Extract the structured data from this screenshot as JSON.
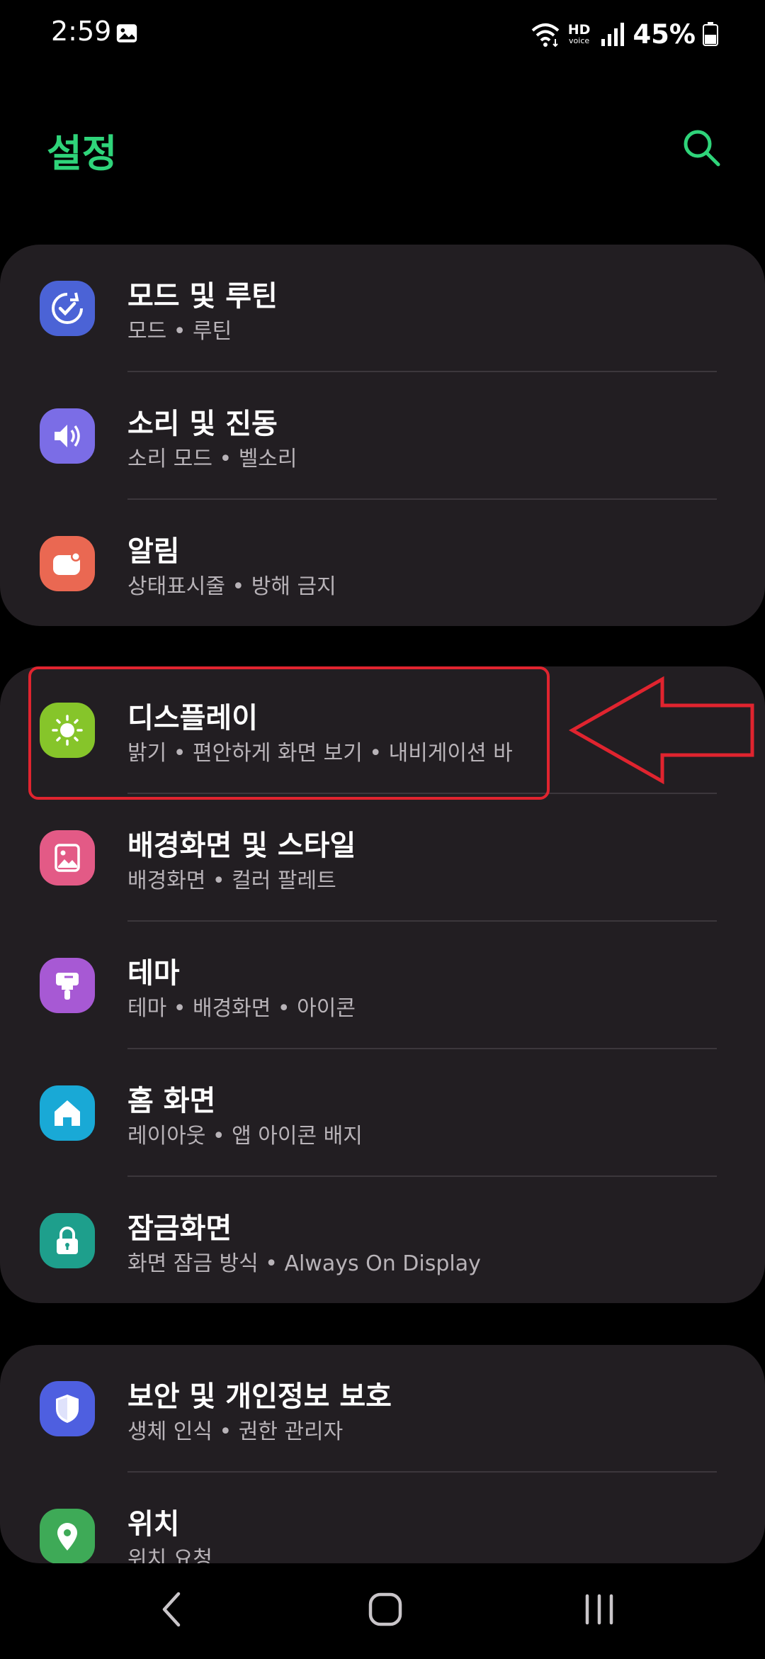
{
  "status_bar": {
    "time": "2:59",
    "hd_top": "HD",
    "hd_bottom": "voice",
    "battery": "45%"
  },
  "header": {
    "title": "설정"
  },
  "groups": [
    {
      "items": [
        {
          "title": "모드 및 루틴",
          "subtitle": "모드 • 루틴",
          "icon": "modes-routines-icon",
          "color": "#4b63d6"
        },
        {
          "title": "소리 및 진동",
          "subtitle": "소리 모드 • 벨소리",
          "icon": "sound-icon",
          "color": "#7b6de6"
        },
        {
          "title": "알림",
          "subtitle": "상태표시줄 • 방해 금지",
          "icon": "notification-icon",
          "color": "#ea6852"
        }
      ]
    },
    {
      "items": [
        {
          "title": "디스플레이",
          "subtitle": "밝기 • 편안하게 화면 보기 • 내비게이션 바",
          "icon": "display-sun-icon",
          "color": "#86c52a"
        },
        {
          "title": "배경화면 및 스타일",
          "subtitle": "배경화면 • 컬러 팔레트",
          "icon": "wallpaper-icon",
          "color": "#e35a86"
        },
        {
          "title": "테마",
          "subtitle": "테마 • 배경화면 • 아이콘",
          "icon": "theme-brush-icon",
          "color": "#a759d4"
        },
        {
          "title": "홈 화면",
          "subtitle": "레이아웃 • 앱 아이콘 배지",
          "icon": "home-icon",
          "color": "#19a9d6"
        },
        {
          "title": "잠금화면",
          "subtitle": "화면 잠금 방식 • Always On Display",
          "icon": "lock-icon",
          "color": "#1e9f8c"
        }
      ]
    },
    {
      "items": [
        {
          "title": "보안 및 개인정보 보호",
          "subtitle": "생체 인식 • 권한 관리자",
          "icon": "shield-icon",
          "color": "#4e5fe0"
        },
        {
          "title": "위치",
          "subtitle": "위치 요청",
          "icon": "location-icon",
          "color": "#3eaa57"
        }
      ]
    }
  ],
  "colors": {
    "accent": "#2fd47a",
    "card": "#221e22",
    "annotation": "#e0242f"
  }
}
